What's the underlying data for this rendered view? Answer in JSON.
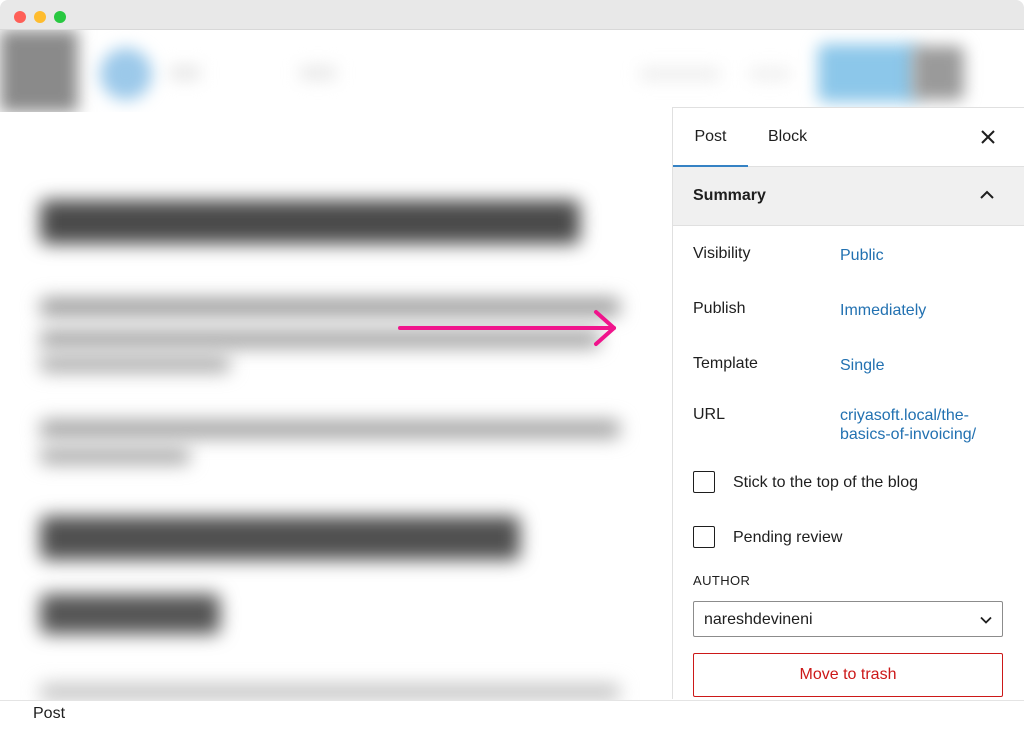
{
  "sidebar": {
    "tabs": [
      {
        "label": "Post"
      },
      {
        "label": "Block"
      }
    ],
    "close_icon": "close-icon",
    "summary": {
      "title": "Summary",
      "rows": [
        {
          "label": "Visibility",
          "value": "Public"
        },
        {
          "label": "Publish",
          "value": "Immediately"
        },
        {
          "label": "Template",
          "value": "Single"
        },
        {
          "label": "URL",
          "value_line1": "criyasoft.local/the-",
          "value_line2": "basics-of-invoicing/"
        }
      ],
      "sticky_label": "Stick to the top of the blog",
      "sticky_checked": false,
      "pending_label": "Pending review",
      "pending_checked": false,
      "author_label": "AUTHOR",
      "author_value": "nareshdevineni",
      "trash_label": "Move to trash"
    }
  },
  "footer": {
    "breadcrumb": "Post"
  },
  "colors": {
    "link": "#2271b1",
    "danger": "#cc1818",
    "arrow": "#f0148c",
    "tab_indicator": "#3582c4"
  }
}
